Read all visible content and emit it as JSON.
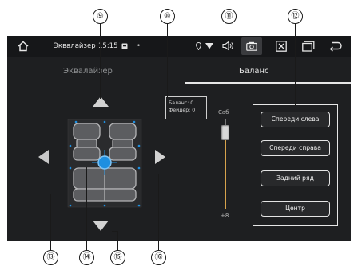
{
  "status_bar": {
    "title": "Эквалайзер",
    "time": "15:15",
    "dot": "•"
  },
  "tabs": [
    {
      "label": "Эквалайзер",
      "active": false
    },
    {
      "label": "Баланс",
      "active": true
    }
  ],
  "balance_info": {
    "balance_line": "Баланс: 0",
    "fader_line": "Фейдер: 0"
  },
  "subwoofer_slider": {
    "top_label": "Саб",
    "bottom_label": "+8"
  },
  "preset_buttons": [
    {
      "label": "Спереди слева"
    },
    {
      "label": "Спереди справа"
    },
    {
      "label": "Задний ряд"
    },
    {
      "label": "Центр"
    }
  ],
  "callouts": [
    "⑨",
    "⑩",
    "⑪",
    "⑫",
    "⑬",
    "⑭",
    "⑮",
    "⑯"
  ],
  "colors": {
    "screen_bg": "#1e1f21",
    "accent_blue": "#1e8fe0",
    "slider_track": "#d6a24c"
  },
  "icons": {
    "home": "home-icon",
    "notification": "notification-icon",
    "location": "location-pin-icon",
    "wifi": "wifi-icon",
    "volume": "volume-icon",
    "screenshot": "camera-icon",
    "close_app": "close-box-icon",
    "recent_apps": "recent-apps-icon",
    "back": "back-icon"
  }
}
